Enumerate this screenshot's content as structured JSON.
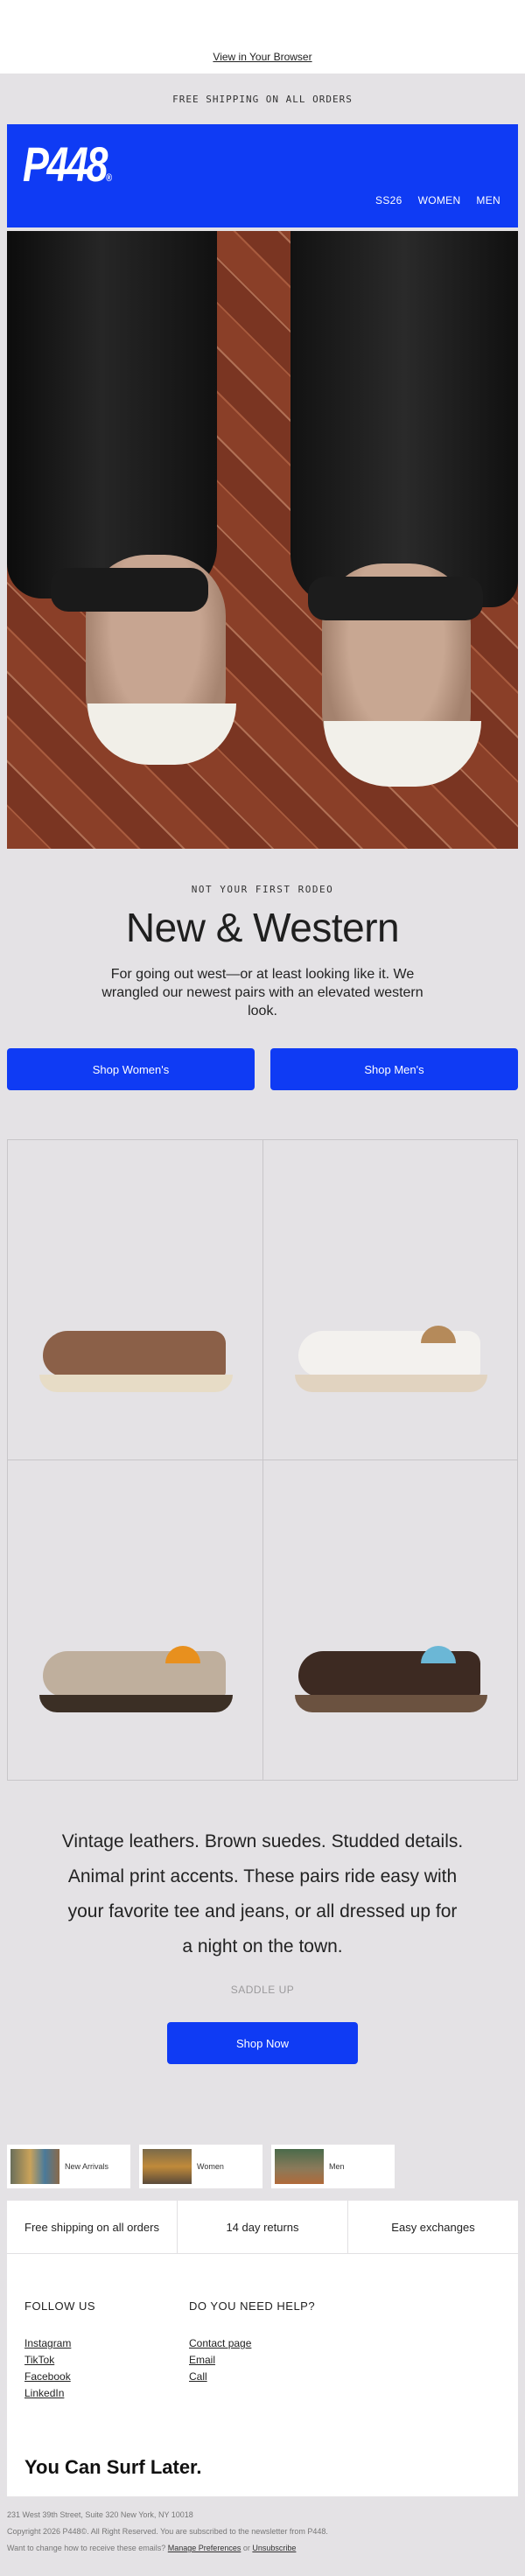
{
  "top": {
    "view_in_browser": "View in Your Browser"
  },
  "announcement": "FREE SHIPPING ON ALL ORDERS",
  "brand": {
    "logo": "P448",
    "reg": "®",
    "blue": "#0f3bf4"
  },
  "nav": [
    "SS26",
    "WOMEN",
    "MEN"
  ],
  "hero": {
    "eyebrow": "NOT YOUR FIRST RODEO",
    "headline": "New & Western",
    "subtext": "For going out west—or at least looking like it. We wrangled our newest pairs with an elevated western look."
  },
  "ctas": {
    "women": "Shop Women's",
    "men": "Shop Men's"
  },
  "products": [
    {
      "icon": "sneaker-brown-suede"
    },
    {
      "icon": "sneaker-white-leopard"
    },
    {
      "icon": "sneaker-taupe-orange-laces"
    },
    {
      "icon": "sneaker-dark-brown-blue"
    }
  ],
  "copy": {
    "body": "Vintage leathers. Brown suedes. Studded details. Animal print accents. These pairs ride easy with your favorite tee and jeans, or all dressed up for a night on the town.",
    "collection": "SADDLE UP",
    "shop_now": "Shop Now"
  },
  "categories": [
    {
      "label": "New Arrivals"
    },
    {
      "label": "Women"
    },
    {
      "label": "Men"
    }
  ],
  "perks": [
    "Free shipping on all orders",
    "14 day returns",
    "Easy exchanges"
  ],
  "footer": {
    "follow_title": "FOLLOW US",
    "social": [
      "Instagram",
      "TikTok",
      "Facebook",
      "LinkedIn"
    ],
    "help_title": "DO YOU NEED HELP?",
    "help": [
      "Contact page",
      "Email",
      "Call"
    ],
    "tagline": "You Can Surf Later."
  },
  "legal": {
    "address": "231 West 39th Street, Suite 320 New York, NY 10018",
    "copyright": "Copyright 2026 P448©. All Right Reserved. You are subscribed to the newsletter from P448.",
    "change_prefix": "Want to change how to receive these emails?",
    "manage": "Manage Preferences",
    "or": "or",
    "unsubscribe": "Unsubscribe"
  }
}
